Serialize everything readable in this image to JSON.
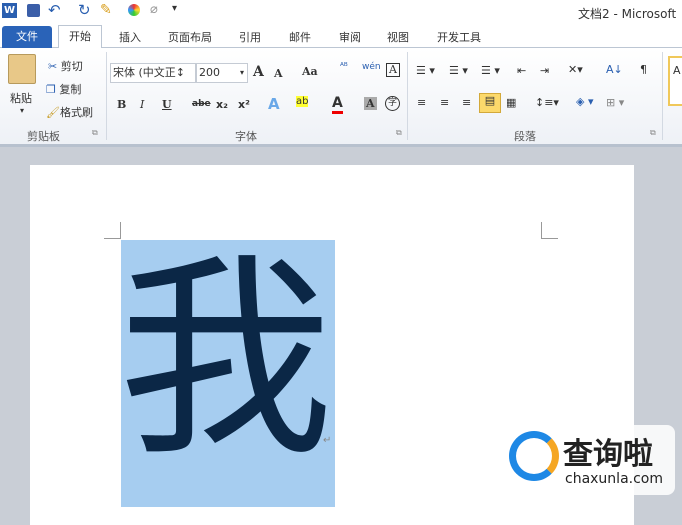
{
  "window": {
    "title": "文档2 - Microsoft"
  },
  "quick_access": {
    "icons": [
      "word-icon",
      "save-icon",
      "undo-icon",
      "redo-icon",
      "paint-icon",
      "color-icon",
      "clear-icon",
      "customize-icon"
    ]
  },
  "tabs": [
    "文件",
    "开始",
    "插入",
    "页面布局",
    "引用",
    "邮件",
    "审阅",
    "视图",
    "开发工具"
  ],
  "clipboard": {
    "paste": "粘贴",
    "cut": "剪切",
    "copy": "复制",
    "format_painter": "格式刷",
    "label": "剪贴板"
  },
  "font": {
    "name": "宋体 (中文正文)",
    "name_display": "宋体 (中文正↕",
    "size": "200",
    "label": "字体",
    "bold": "B",
    "italic": "I",
    "underline": "U",
    "strike": "abe",
    "sub": "x₂",
    "sup": "x²",
    "grow": "A",
    "shrink": "A",
    "case": "Aa",
    "phonetic": "wén",
    "border": "A",
    "shade": "A",
    "enclose": "字"
  },
  "paragraph": {
    "label": "段落"
  },
  "styles": {
    "preview": "A"
  },
  "document": {
    "text": "我",
    "paragraph_mark": "↵",
    "selection_color": "#a6cdf0",
    "text_color": "#0b2746"
  },
  "watermark": {
    "name": "查询啦",
    "url": "chaxunla.com"
  }
}
